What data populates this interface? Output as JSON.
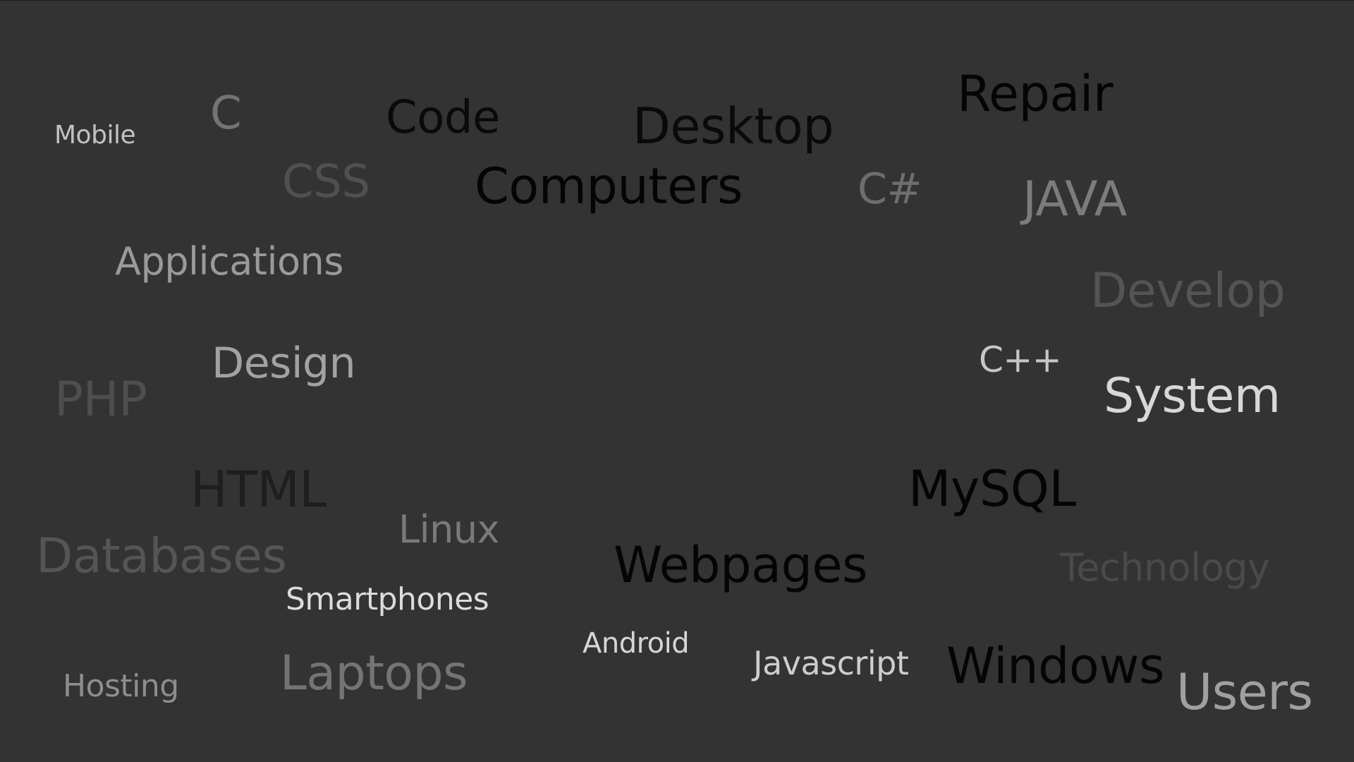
{
  "background_color": "#333333",
  "words": [
    {
      "key": "mobile",
      "text": "Mobile",
      "color": "#c2c2c2"
    },
    {
      "key": "c",
      "text": "C",
      "color": "#747474"
    },
    {
      "key": "code",
      "text": "Code",
      "color": "#0a0a0a"
    },
    {
      "key": "desktop",
      "text": "Desktop",
      "color": "#0a0a0a"
    },
    {
      "key": "repair",
      "text": "Repair",
      "color": "#050505"
    },
    {
      "key": "css",
      "text": "CSS",
      "color": "#505050"
    },
    {
      "key": "computers",
      "text": "Computers",
      "color": "#050505"
    },
    {
      "key": "csharp",
      "text": "C#",
      "color": "#6e6e6e"
    },
    {
      "key": "java",
      "text": "JAVA",
      "color": "#7c7c7c"
    },
    {
      "key": "applications",
      "text": "Applications",
      "color": "#9a9a9a"
    },
    {
      "key": "develop",
      "text": "Develop",
      "color": "#545454"
    },
    {
      "key": "design",
      "text": "Design",
      "color": "#a2a2a2"
    },
    {
      "key": "cpp",
      "text": "C++",
      "color": "#c6c6c6"
    },
    {
      "key": "php",
      "text": "PHP",
      "color": "#4e4e4e"
    },
    {
      "key": "system",
      "text": "System",
      "color": "#d8d8d8"
    },
    {
      "key": "html",
      "text": "HTML",
      "color": "#1e1e1e"
    },
    {
      "key": "mysql",
      "text": "MySQL",
      "color": "#050505"
    },
    {
      "key": "linux",
      "text": "Linux",
      "color": "#7a7a7a"
    },
    {
      "key": "databases",
      "text": "Databases",
      "color": "#555555"
    },
    {
      "key": "webpages",
      "text": "Webpages",
      "color": "#050505"
    },
    {
      "key": "technology",
      "text": "Technology",
      "color": "#4a4a4a"
    },
    {
      "key": "smartphones",
      "text": "Smartphones",
      "color": "#dcdcdc"
    },
    {
      "key": "android",
      "text": "Android",
      "color": "#d6d6d6"
    },
    {
      "key": "javascript",
      "text": "Javascript",
      "color": "#cecece"
    },
    {
      "key": "windows",
      "text": "Windows",
      "color": "#050505"
    },
    {
      "key": "hosting",
      "text": "Hosting",
      "color": "#8e8e8e"
    },
    {
      "key": "laptops",
      "text": "Laptops",
      "color": "#747474"
    },
    {
      "key": "users",
      "text": "Users",
      "color": "#a0a0a0"
    }
  ]
}
